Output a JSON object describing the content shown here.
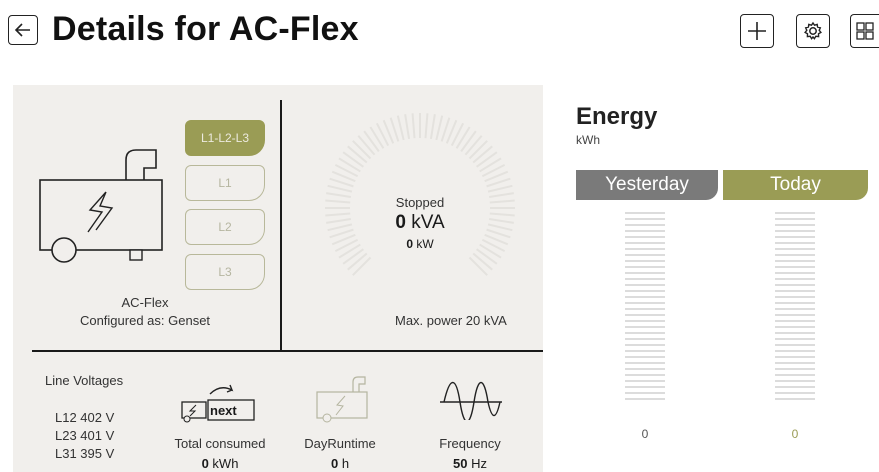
{
  "header": {
    "title": "Details for AC-Flex"
  },
  "device": {
    "name": "AC-Flex",
    "configured_as": "Configured as: Genset"
  },
  "phases": [
    {
      "label": "L1-L2-L3",
      "active": true
    },
    {
      "label": "L1",
      "active": false
    },
    {
      "label": "L2",
      "active": false
    },
    {
      "label": "L3",
      "active": false
    }
  ],
  "gauge": {
    "status": "Stopped",
    "kva_value": "0",
    "kva_unit": "kVA",
    "kw_value": "0",
    "kw_unit": "kW",
    "max_power": "Max. power 20 kVA"
  },
  "line_voltages": {
    "title": "Line Voltages",
    "items": [
      "L12 402 V",
      "L23 401 V",
      "L31 395 V"
    ]
  },
  "stats": {
    "next_label": "next",
    "total_consumed": {
      "label": "Total consumed",
      "value": "0",
      "unit": "kWh"
    },
    "day_runtime": {
      "label": "DayRuntime",
      "value": "0",
      "unit": "h"
    },
    "frequency": {
      "label": "Frequency",
      "value": "50",
      "unit": "Hz"
    }
  },
  "energy": {
    "title": "Energy",
    "unit": "kWh",
    "yesterday": {
      "label": "Yesterday",
      "value": "0"
    },
    "today": {
      "label": "Today",
      "value": "0"
    }
  },
  "colors": {
    "accent": "#9a9c55",
    "yesterday_tab": "#7a7a7a",
    "panel_bg": "#f1efec"
  },
  "icons": [
    "back-arrow-icon",
    "plus-icon",
    "gear-icon",
    "grid-icon",
    "genset-icon",
    "next-genset-icon",
    "runtime-genset-icon",
    "sine-wave-icon"
  ]
}
